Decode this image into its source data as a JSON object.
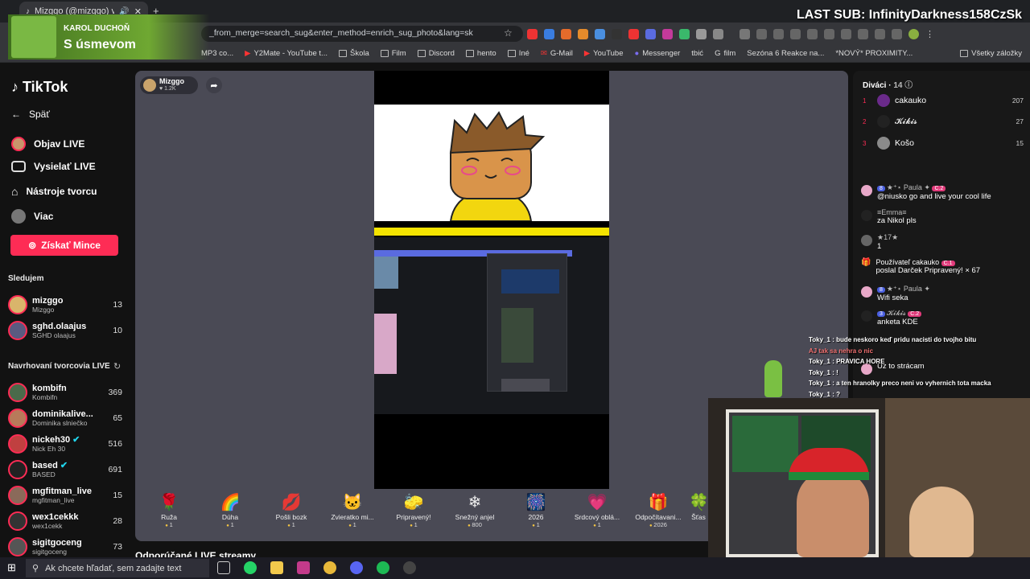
{
  "browser": {
    "tab_title": "Mizggo (@mizggo) vysiela",
    "url": "_from_merge=search_sug&enter_method=enrich_sug_photo&lang=sk",
    "bookmarks": [
      "MP3 co...",
      "Y2Mate - YouTube t...",
      "Škola",
      "Film",
      "Discord",
      "hento",
      "Iné",
      "G-Mail",
      "YouTube",
      "Messenger",
      "tbić",
      "film",
      "Sezóna 6 Reakce na...",
      "*NOVÝ* PROXIMITY...",
      "Všetky záložky"
    ]
  },
  "overlay": {
    "last_sub": "LAST SUB: InfinityDarkness158CzSk",
    "song_artist": "KAROL DUCHOŇ",
    "song_title": "S úsmevom",
    "toky_chat": [
      "Toky_1 : bude neskoro keď pridu nacisti do tvojho bitu",
      "AJ tak sa nehra o nic",
      "Toky_1 : PRAVICA HORE",
      "Toky_1 : !",
      "Toky_1 : a ten hranolky preco neni vo vyhernich tota macka",
      "Toky_1 : ?"
    ]
  },
  "sidebar": {
    "logo": "TikTok",
    "back": "Späť",
    "items": [
      "Objav LIVE",
      "Vysielať LIVE",
      "Nástroje tvorcu",
      "Viac"
    ],
    "coins_button": "Získať Mince",
    "following_title": "Sledujem",
    "following": [
      {
        "name": "mizggo",
        "sub": "Mizggo",
        "count": "13"
      },
      {
        "name": "sghd.olaajus",
        "sub": "SGHD olaajus",
        "count": "10"
      }
    ],
    "suggested_title": "Navrhovaní tvorcovia LIVE",
    "suggested": [
      {
        "name": "kombifn",
        "sub": "Kombifn",
        "count": "369"
      },
      {
        "name": "dominikalive...",
        "sub": "Dominika slniečko",
        "count": "65"
      },
      {
        "name": "nickeh30",
        "sub": "Nick Eh 30",
        "count": "516"
      },
      {
        "name": "based",
        "sub": "BASED",
        "count": "691"
      },
      {
        "name": "mgfitman_live",
        "sub": "mgfitman_live",
        "count": "15"
      },
      {
        "name": "wex1cekkk",
        "sub": "wex1cekk",
        "count": "28"
      },
      {
        "name": "sigitgoceng",
        "sub": "sigitgoceng",
        "count": "73"
      }
    ]
  },
  "stage": {
    "host_name": "Mizggo",
    "host_likes": "1.2K",
    "gifts": [
      {
        "name": "Ruža",
        "price": "1",
        "icon": "🌹"
      },
      {
        "name": "Dúha",
        "price": "1",
        "icon": "🌈"
      },
      {
        "name": "Pošli bozk",
        "price": "1",
        "icon": "💋"
      },
      {
        "name": "Zvieratko mi...",
        "price": "1",
        "icon": "🐱"
      },
      {
        "name": "Pripravený!",
        "price": "1",
        "icon": "🧽"
      },
      {
        "name": "Snežný anjel",
        "price": "800",
        "icon": "❄"
      },
      {
        "name": "2026",
        "price": "1",
        "icon": "🎆"
      },
      {
        "name": "Srdcový oblá...",
        "price": "1",
        "icon": "💗"
      },
      {
        "name": "Odpočítavani...",
        "price": "2026",
        "icon": "🎁"
      },
      {
        "name": "Šťas",
        "price": "",
        "icon": "🍀"
      }
    ],
    "recommended": "Odporúčané LIVE streamy"
  },
  "viewers": {
    "title": "Diváci",
    "count": "14",
    "list": [
      {
        "rank": "1",
        "name": "cakauko",
        "score": "207",
        "color": "#6a2a8a"
      },
      {
        "rank": "2",
        "name": "𝓚𝓲𝓴𝓲𝓼",
        "score": "27",
        "color": "#222"
      },
      {
        "rank": "3",
        "name": "Košo",
        "score": "15",
        "color": "#8a8a8a"
      }
    ]
  },
  "chat": [
    {
      "user": "★⁺⋆ Paula ✦",
      "msg": "@niusko go and live your cool life"
    },
    {
      "user": "≡Emma≡",
      "msg": "za Nikol pls"
    },
    {
      "user": "★17★",
      "msg": "1"
    },
    {
      "user": "Používateľ cakauko",
      "msg": "poslal Darček Pripravený! × 67"
    },
    {
      "user": "★⁺⋆ Paula ✦",
      "msg": "Wifi seka"
    },
    {
      "user": "𝓚𝓲𝓴𝓲𝓼",
      "msg": "anketa KDE"
    },
    {
      "user": "",
      "msg": "Uz to strácam"
    }
  ],
  "taskbar": {
    "search_placeholder": "Ak chcete hľadať, sem zadajte text"
  }
}
